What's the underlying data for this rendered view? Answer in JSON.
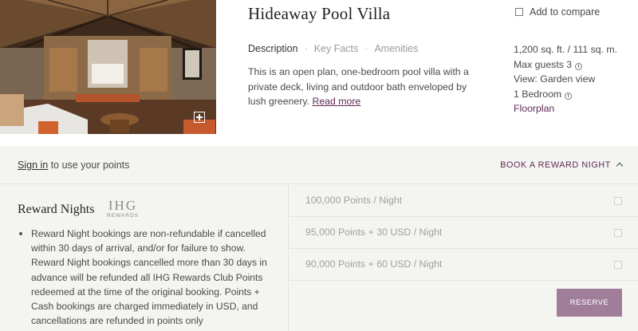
{
  "room": {
    "title": "Hideaway Pool Villa",
    "photo_alt": "Room photo",
    "tabs": [
      {
        "label": "Description",
        "active": true
      },
      {
        "label": "Key Facts",
        "active": false
      },
      {
        "label": "Amenities",
        "active": false
      }
    ],
    "tab_separator": "·",
    "description": "This is an open plan, one-bedroom pool villa with a private deck, living and outdoor bath enveloped by lush greenery.",
    "read_more": "Read more",
    "compare_label": "Add to compare",
    "facts": {
      "size": "1,200 sq. ft. / 111 sq. m.",
      "max_guests": "Max guests 3",
      "view": "View: Garden view",
      "bedrooms": "1 Bedroom",
      "floorplan": "Floorplan"
    },
    "info_glyph": "i"
  },
  "booking": {
    "signin_link": "Sign in",
    "signin_text": " to use your points",
    "book_reward": "BOOK A REWARD NIGHT",
    "reward_title": "Reward Nights",
    "logo_main": "IHG",
    "logo_sub": "REWARDS",
    "policy": "Reward Night bookings are non-refundable if cancelled within 30 days of arrival, and/or for failure to show. Reward Night bookings cancelled more than 30 days in advance will be refunded all IHG Rewards Club Points redeemed at the time of the original booking. Points + Cash bookings are charged immediately in USD, and cancellations are refunded in points only",
    "options": [
      {
        "label": "100,000 Points / Night",
        "checked": false
      },
      {
        "label": "95,000 Points + 30 USD / Night",
        "checked": false
      },
      {
        "label": "90,000 Points + 60 USD / Night",
        "checked": false
      }
    ],
    "reserve": "RESERVE"
  },
  "colors": {
    "accent": "#5d2a55",
    "reserve_button": "#a07e9a",
    "panel_bg": "#f4f4f1"
  },
  "icons": {
    "expand": "expand-plus-icon",
    "info": "info-icon",
    "chevron": "chevron-up-icon",
    "bullet": "bullet-icon"
  }
}
